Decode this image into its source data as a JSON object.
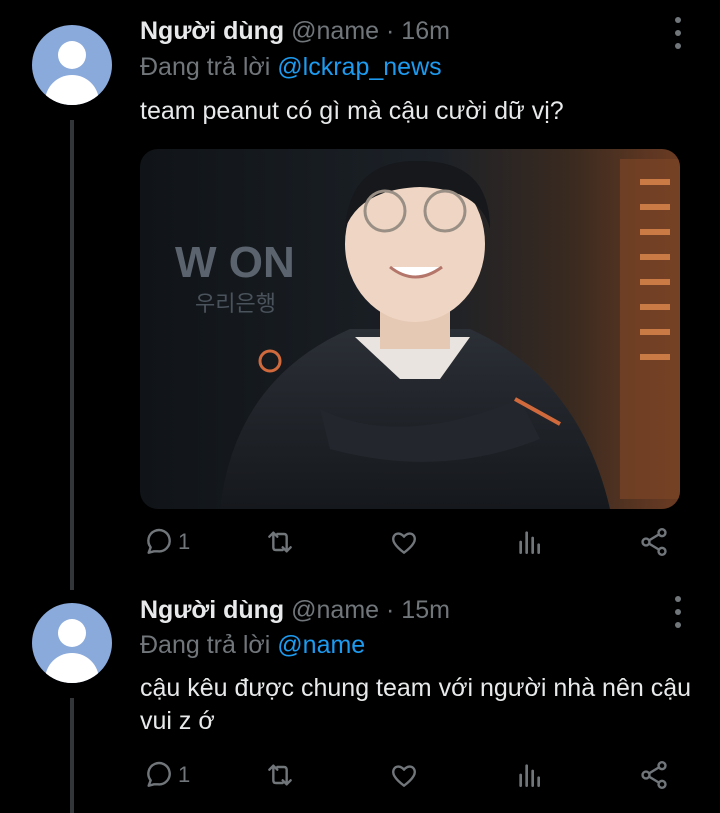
{
  "tweets": [
    {
      "display_name": "Người dùng",
      "handle": "@name",
      "separator": "·",
      "time": "16m",
      "reply_prefix": "Đang trả lời",
      "reply_to": "@lckrap_news",
      "text": "team peanut có gì mà cậu cười dữ vị?",
      "reply_count": "1",
      "icons": [
        "reply-icon",
        "retweet-icon",
        "like-icon",
        "views-icon",
        "share-icon"
      ],
      "media": {
        "sign_text": "W ON",
        "sign_sub": "우리은행",
        "bg_colors": [
          "#14181c",
          "#2a2d33",
          "#5a3a22",
          "#c76b3a"
        ]
      }
    },
    {
      "display_name": "Người dùng",
      "handle": "@name",
      "separator": "·",
      "time": "15m",
      "reply_prefix": "Đang trả lời",
      "reply_to": "@name",
      "text": "cậu kêu được chung team với người nhà nên cậu vui z ớ",
      "reply_count": "1",
      "icons": [
        "reply-icon",
        "retweet-icon",
        "like-icon",
        "views-icon",
        "share-icon"
      ]
    }
  ],
  "colors": {
    "background": "#000000",
    "text": "#e7e9ea",
    "muted": "#71767b",
    "accent": "#1d9bf0",
    "avatar": "#8aaadb"
  }
}
